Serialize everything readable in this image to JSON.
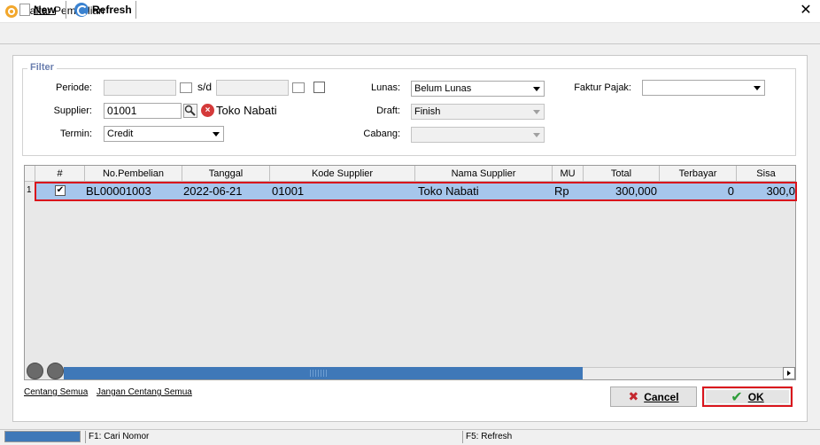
{
  "window": {
    "title": "Daftar Pembelian",
    "close_glyph": "✕"
  },
  "toolbar": {
    "new_label": "New",
    "refresh_label": "Refresh"
  },
  "filter": {
    "legend": "Filter",
    "periode_label": "Periode:",
    "periode_from": "",
    "sd_label": "s/d",
    "periode_to": "",
    "supplier_label": "Supplier:",
    "supplier_code": "01001",
    "supplier_name": "Toko Nabati",
    "termin_label": "Termin:",
    "termin_value": "Credit",
    "lunas_label": "Lunas:",
    "lunas_value": "Belum Lunas",
    "draft_label": "Draft:",
    "draft_value": "Finish",
    "cabang_label": "Cabang:",
    "cabang_value": "",
    "faktur_pajak_label": "Faktur Pajak:",
    "faktur_pajak_value": ""
  },
  "grid": {
    "columns": [
      "#",
      "No.Pembelian",
      "Tanggal",
      "Kode Supplier",
      "Nama Supplier",
      "MU",
      "Total",
      "Terbayar",
      "Sisa"
    ],
    "rows": [
      {
        "num": "1",
        "checked": "✔",
        "no_pembelian": "BL00001003",
        "tanggal": "2022-06-21",
        "kode_supplier": "01001",
        "nama_supplier": "Toko Nabati",
        "mu": "Rp",
        "total": "300,000",
        "terbayar": "0",
        "sisa": "300,0"
      }
    ]
  },
  "links": {
    "check_all": "Centang Semua",
    "uncheck_all": "Jangan Centang Semua"
  },
  "buttons": {
    "cancel_label": "Cancel",
    "cancel_glyph": "✖",
    "ok_label": "OK",
    "ok_glyph": "✔"
  },
  "statusbar": {
    "f1": "F1: Cari Nomor",
    "f5": "F5: Refresh"
  }
}
